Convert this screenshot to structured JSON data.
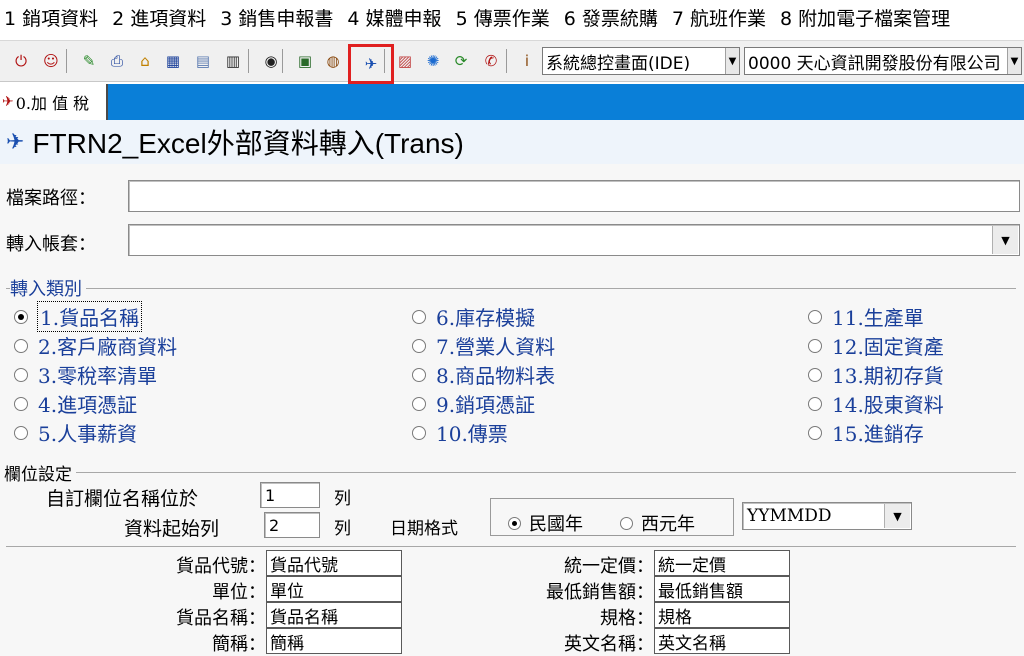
{
  "menu": [
    "1 銷項資料",
    "2 進項資料",
    "3 銷售申報書",
    "4 媒體申報",
    "5 傳票作業",
    "6 發票統購",
    "7 航班作業",
    "8 附加電子檔案管理"
  ],
  "toolbar": {
    "buttons": [
      {
        "name": "exit-icon",
        "glyph": "⏻",
        "color": "#b01010"
      },
      {
        "name": "users-icon",
        "glyph": "☺",
        "color": "#b01010"
      },
      {
        "name": "tools-icon",
        "glyph": "✎",
        "color": "#2a8a2a"
      },
      {
        "name": "printer-icon",
        "glyph": "⎙",
        "color": "#1a3f9a"
      },
      {
        "name": "home-icon",
        "glyph": "⌂",
        "color": "#c08000"
      },
      {
        "name": "grid-icon",
        "glyph": "▦",
        "color": "#1a3f9a"
      },
      {
        "name": "notes-icon",
        "glyph": "▤",
        "color": "#5a7ab0"
      },
      {
        "name": "calculator-icon",
        "glyph": "▥",
        "color": "#303030"
      },
      {
        "name": "eye-icon",
        "glyph": "◉",
        "color": "#202020"
      },
      {
        "name": "monitor-icon",
        "glyph": "▣",
        "color": "#2a6a2a"
      },
      {
        "name": "globe-icon",
        "glyph": "◍",
        "color": "#8a4a10"
      },
      {
        "name": "excel-import-icon",
        "glyph": "✈",
        "color": "#1a4fb0"
      },
      {
        "name": "calendar-icon",
        "glyph": "▨",
        "color": "#c04040"
      },
      {
        "name": "settings-icon",
        "glyph": "✺",
        "color": "#1a6ad0"
      },
      {
        "name": "refresh-icon",
        "glyph": "⟳",
        "color": "#2a8a2a"
      },
      {
        "name": "camera-icon",
        "glyph": "✆",
        "color": "#b01010"
      },
      {
        "name": "info-icon",
        "glyph": "i",
        "color": "#8a4a10"
      }
    ],
    "system_combo": "系統總控畫面(IDE)",
    "company_combo": "0000  天心資訊開發股份有限公司"
  },
  "tab": {
    "label": "0.加 值 稅"
  },
  "title": "FTRN2_Excel外部資料轉入(Trans)",
  "form": {
    "path_label": "檔案路徑：",
    "path_value": "",
    "account_label": "轉入帳套：",
    "account_value": ""
  },
  "import_type": {
    "title": "轉入類別",
    "options": [
      {
        "label": "1.貨品名稱",
        "selected": true
      },
      {
        "label": "2.客戶廠商資料",
        "selected": false
      },
      {
        "label": "3.零稅率清單",
        "selected": false
      },
      {
        "label": "4.進項憑証",
        "selected": false
      },
      {
        "label": "5.人事薪資",
        "selected": false
      },
      {
        "label": "6.庫存模擬",
        "selected": false
      },
      {
        "label": "7.營業人資料",
        "selected": false
      },
      {
        "label": "8.商品物料表",
        "selected": false
      },
      {
        "label": "9.銷項憑証",
        "selected": false
      },
      {
        "label": "10.傳票",
        "selected": false
      },
      {
        "label": "11.生產單",
        "selected": false
      },
      {
        "label": "12.固定資產",
        "selected": false
      },
      {
        "label": "13.期初存貨",
        "selected": false
      },
      {
        "label": "14.股東資料",
        "selected": false
      },
      {
        "label": "15.進銷存",
        "selected": false
      }
    ]
  },
  "field_settings": {
    "title": "欄位設定",
    "header_row_label": "自訂欄位名稱位於",
    "header_row_value": "1",
    "start_row_label": "資料起始列",
    "start_row_value": "2",
    "row_unit": "列",
    "date_format_label": "日期格式",
    "date_options": [
      {
        "label": "民國年",
        "selected": true
      },
      {
        "label": "西元年",
        "selected": false
      }
    ],
    "date_pattern": "YYMMDD"
  },
  "mapping": {
    "left": [
      {
        "label": "貨品代號：",
        "value": "貨品代號"
      },
      {
        "label": "單位：",
        "value": "單位"
      },
      {
        "label": "貨品名稱：",
        "value": "貨品名稱"
      },
      {
        "label": "簡稱：",
        "value": "簡稱"
      }
    ],
    "right": [
      {
        "label": "統一定價：",
        "value": "統一定價"
      },
      {
        "label": "最低銷售額：",
        "value": "最低銷售額"
      },
      {
        "label": "規格：",
        "value": "規格"
      },
      {
        "label": "英文名稱：",
        "value": "英文名稱"
      }
    ]
  }
}
